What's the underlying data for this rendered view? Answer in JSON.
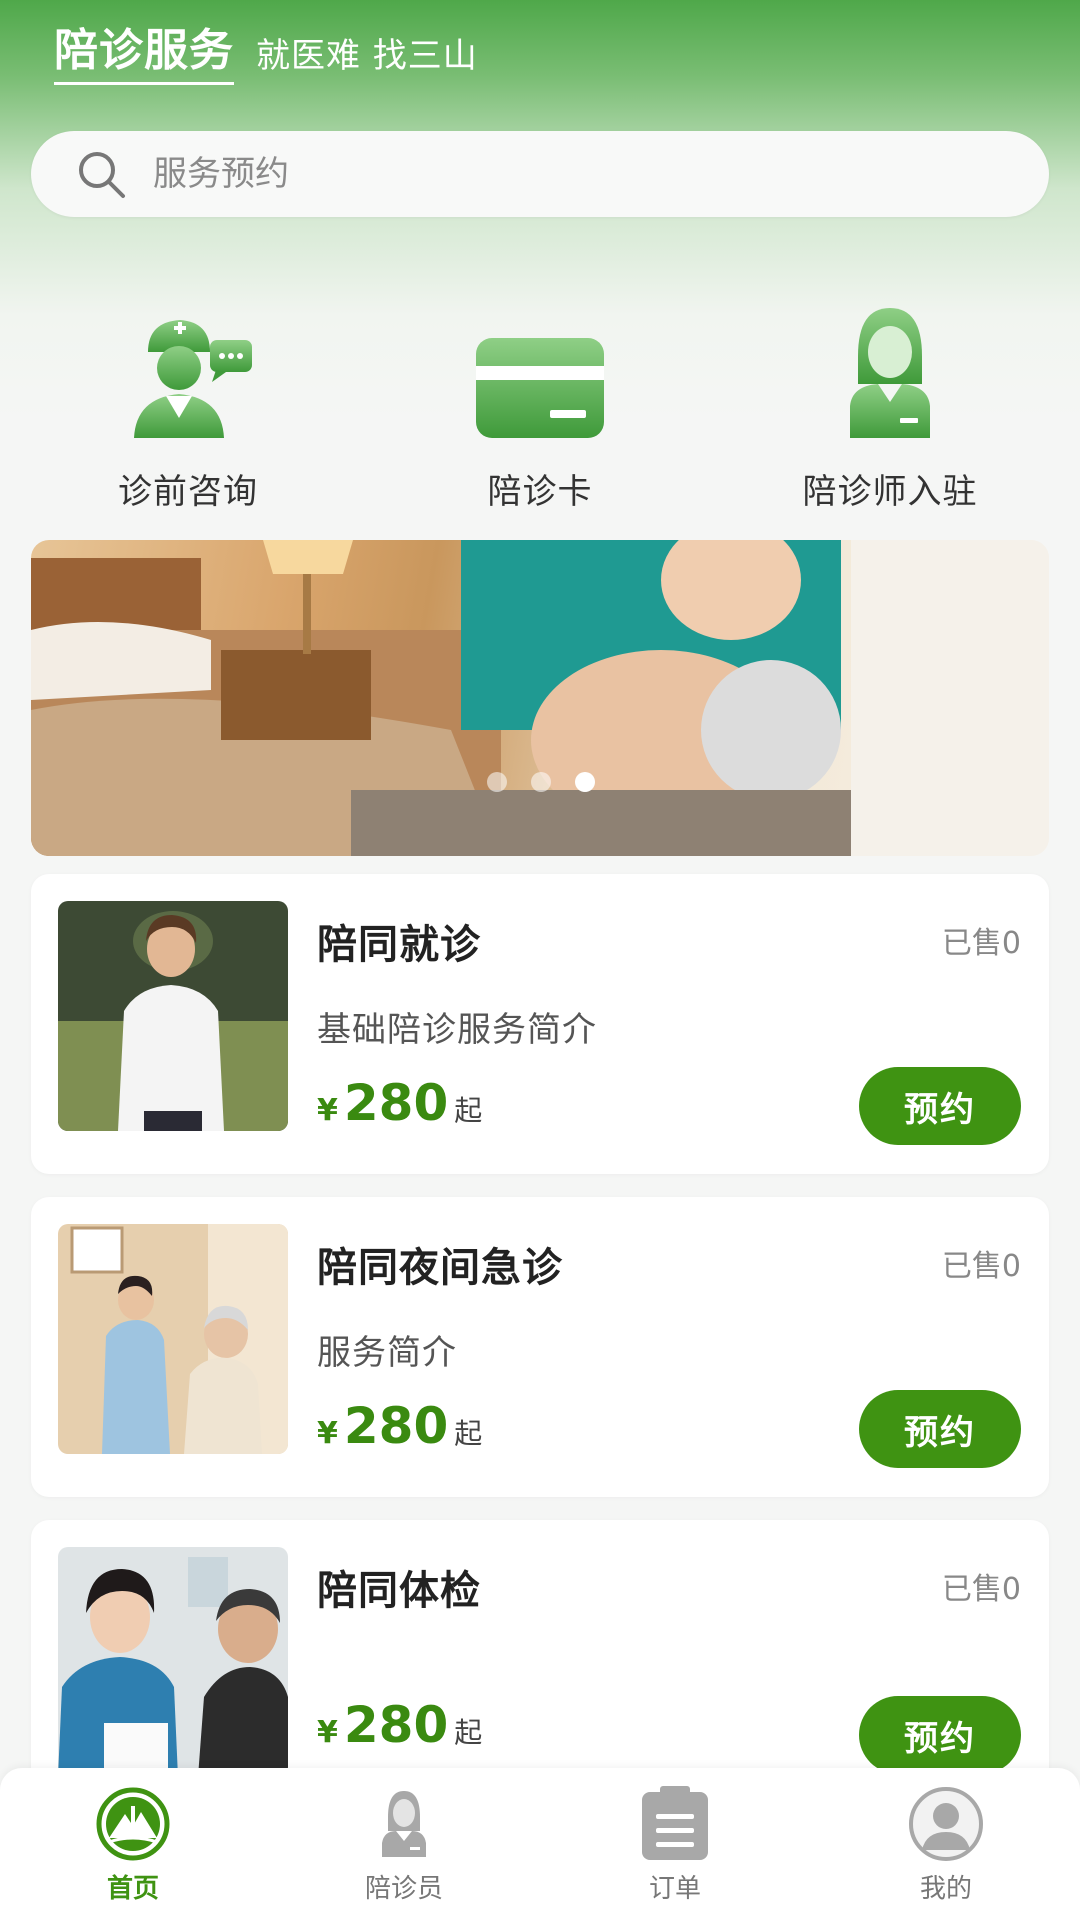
{
  "header": {
    "title": "陪诊服务",
    "slogan": "就医难 找三山"
  },
  "search": {
    "placeholder": "服务预约",
    "icon": "search-icon"
  },
  "quick_entries": [
    {
      "label": "诊前咨询",
      "icon": "nurse-consult-icon"
    },
    {
      "label": "陪诊卡",
      "icon": "card-icon"
    },
    {
      "label": "陪诊师入驻",
      "icon": "escort-register-icon"
    }
  ],
  "banner": {
    "slide_count": 3,
    "active_index": 2
  },
  "services": [
    {
      "name": "陪同就诊",
      "sold": "已售0",
      "desc": "基础陪诊服务简介",
      "currency": "¥",
      "price": "280",
      "suffix": "起",
      "button": "预约"
    },
    {
      "name": "陪同夜间急诊",
      "sold": "已售0",
      "desc": "服务简介",
      "currency": "¥",
      "price": "280",
      "suffix": "起",
      "button": "预约"
    },
    {
      "name": "陪同体检",
      "sold": "已售0",
      "desc": "",
      "currency": "¥",
      "price": "280",
      "suffix": "起",
      "button": "预约"
    }
  ],
  "tabbar": [
    {
      "label": "首页",
      "icon": "home-logo-icon",
      "active": true
    },
    {
      "label": "陪诊员",
      "icon": "escort-icon",
      "active": false
    },
    {
      "label": "订单",
      "icon": "clipboard-icon",
      "active": false
    },
    {
      "label": "我的",
      "icon": "user-avatar-icon",
      "active": false
    }
  ],
  "colors": {
    "brand_green": "#3f9312",
    "price_green": "#3a8a10",
    "header_green": "#4fa84a"
  }
}
